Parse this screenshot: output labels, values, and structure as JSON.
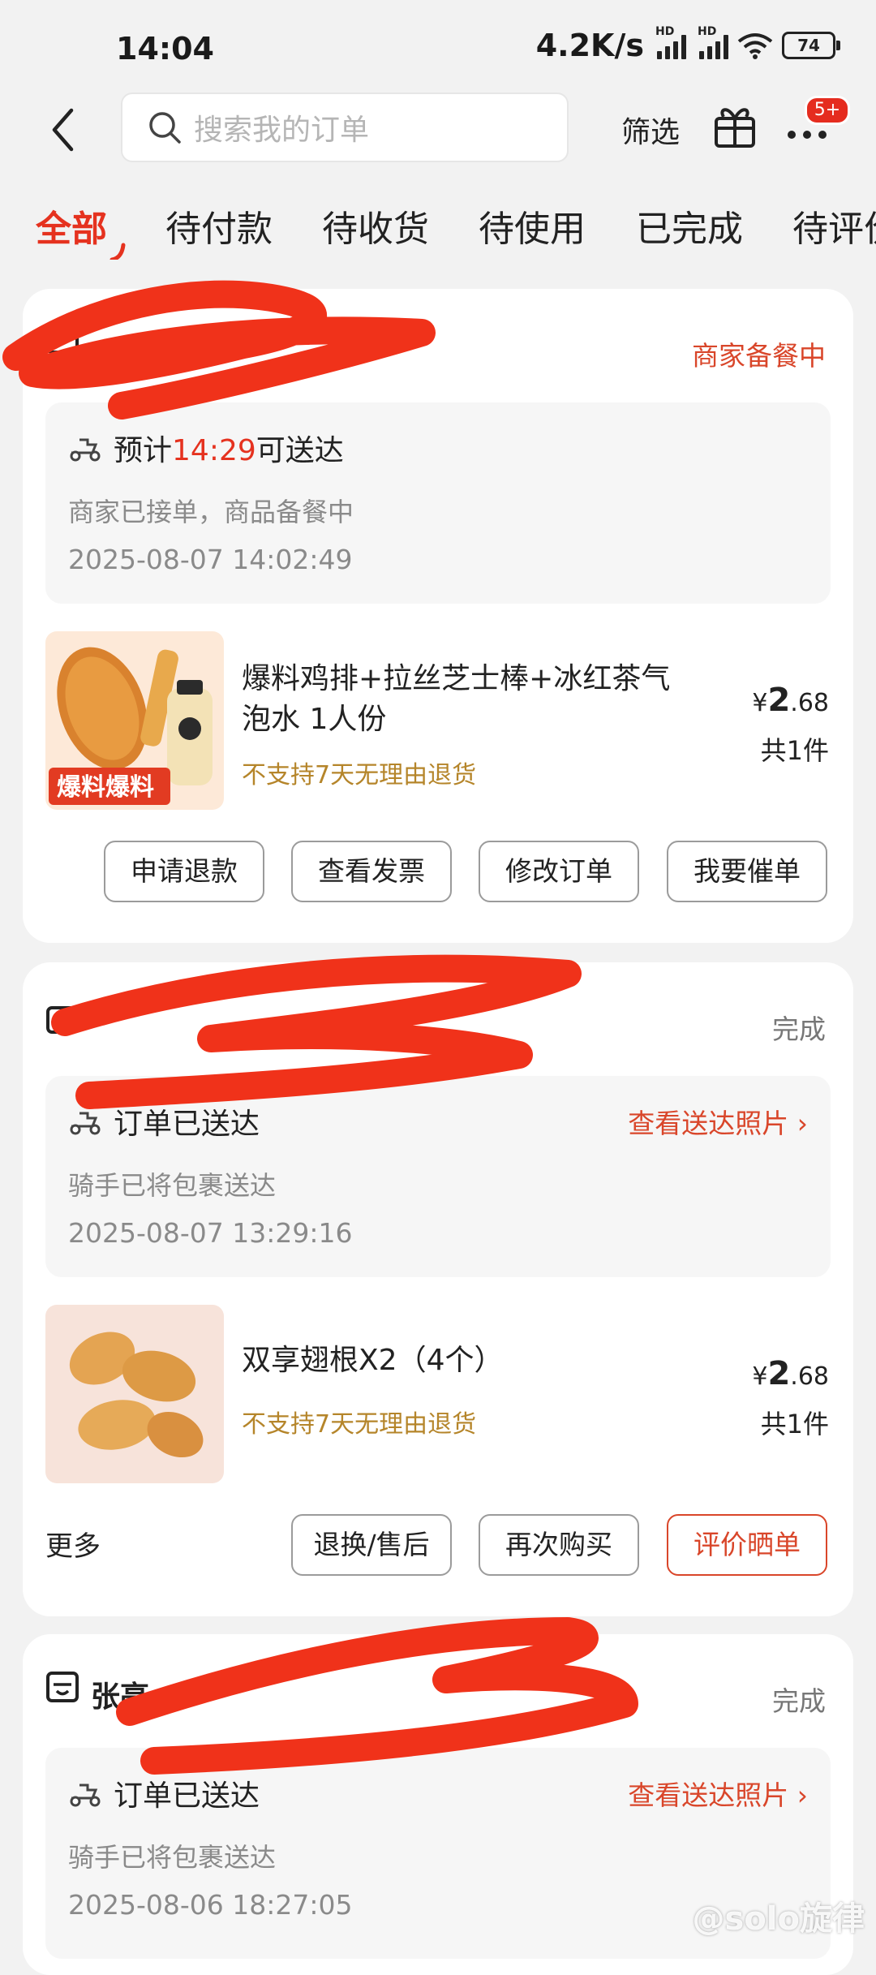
{
  "status_bar": {
    "time": "14:04",
    "speed": "4.2K/s",
    "battery": "74"
  },
  "header": {
    "search_placeholder": "搜索我的订单",
    "filter_label": "筛选",
    "badge": "5+"
  },
  "tabs": [
    "全部",
    "待付款",
    "待收货",
    "待使用",
    "已完成",
    "待评价"
  ],
  "orders": [
    {
      "status": "商家备餐中",
      "eta_prefix": "预计",
      "eta_time": "14:29",
      "eta_suffix": "可送达",
      "desc": "商家已接单，商品备餐中",
      "timestamp": "2025-08-07 14:02:49",
      "product": "爆料鸡排+拉丝芝士棒+冰红茶气泡水 1人份",
      "no_return": "不支持7天无理由退货",
      "price_symbol": "¥",
      "price_int": "2",
      "price_dec": ".68",
      "qty": "共1件",
      "buttons": [
        "申请退款",
        "查看发票",
        "修改订单",
        "我要催单"
      ]
    },
    {
      "status": "完成",
      "title": "订单已送达",
      "photo_link": "查看送达照片",
      "desc": "骑手已将包裹送达",
      "timestamp": "2025-08-07 13:29:16",
      "product": "双享翅根X2（4个）",
      "no_return": "不支持7天无理由退货",
      "price_symbol": "¥",
      "price_int": "2",
      "price_dec": ".68",
      "qty": "共1件",
      "more": "更多",
      "buttons": [
        "退换/售后",
        "再次购买",
        "评价晒单"
      ]
    },
    {
      "shop_name_visible": "张亮",
      "status": "完成",
      "title": "订单已送达",
      "photo_link": "查看送达照片",
      "desc": "骑手已将包裹送达",
      "timestamp": "2025-08-06 18:27:05"
    }
  ],
  "watermark": "@solo旋律",
  "colors": {
    "accent": "#e5321f",
    "orange_text": "#d9462a",
    "gold_text": "#b5852a",
    "redaction": "#f0321a"
  }
}
